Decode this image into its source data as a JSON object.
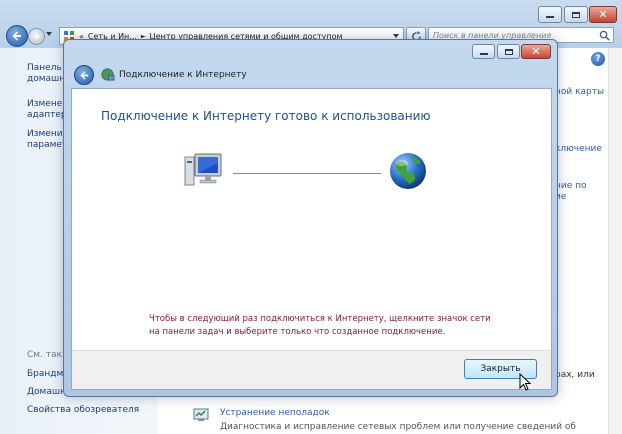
{
  "background_window": {
    "address_parts": [
      "«",
      "Сеть и Ин...",
      "►",
      "Центр управления сетями и общим доступом"
    ],
    "search_placeholder": "Поиск в панели управления",
    "left_pane": {
      "links": [
        "Панель у",
        "домашн",
        "Изменен",
        "адаптер",
        "Изменит",
        "параметр"
      ],
      "see_also": "См. такж",
      "bottom_links": [
        "Брандма",
        "Домашн",
        "Свойства обозревателя"
      ]
    },
    "right_fragments": [
      "ной карты",
      "ключение",
      "ние по",
      "ие",
      "рах, или"
    ],
    "troubleshoot": {
      "title": "Устранение неполадок",
      "description": "Диагностика и исправление сетевых проблем или получение сведений об"
    }
  },
  "dialog": {
    "title": "Подключение к Интернету",
    "heading": "Подключение к Интернету готово к использованию",
    "message": "Чтобы в следующий раз подключиться к Интернету, щелкните значок сети на панели задач и выберите только что созданное подключение.",
    "close_button": "Закрыть"
  },
  "icons": {
    "back": "back-arrow-icon",
    "forward": "forward-arrow-icon",
    "computer": "computer-icon",
    "globe": "globe-icon",
    "help": "help-icon",
    "search": "search-icon"
  },
  "colors": {
    "heading_blue": "#1f4e93",
    "message_red": "#8a1c36",
    "link_blue": "#2f5ea6"
  }
}
